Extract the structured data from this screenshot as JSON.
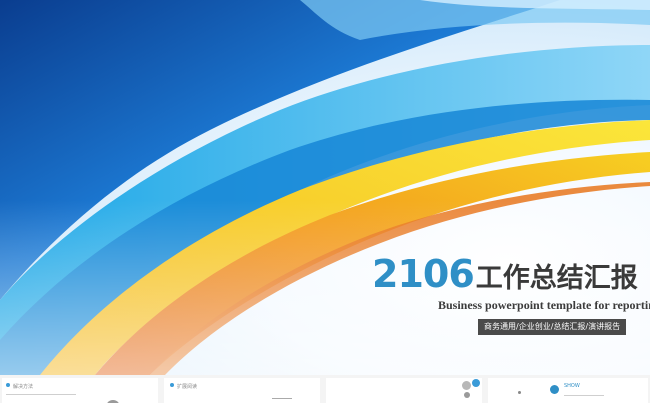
{
  "slide": {
    "title_number": "2106",
    "title_text": "工作总结汇报",
    "subtitle": "Business powerpoint template for reporting",
    "tagline": "商务通用/企业创业/总结汇报/演讲报告"
  },
  "colors": {
    "accent_blue": "#2f8fc6",
    "dark_text": "#3a3a3a",
    "tag_bg": "#4a4a4a",
    "orange": "#f08a1c",
    "yellow": "#f7d21a"
  },
  "thumbnails": [
    {
      "label": "解决方法"
    },
    {
      "label": "扩展阅读"
    },
    {
      "label": ""
    },
    {
      "label": "SHOW"
    }
  ]
}
